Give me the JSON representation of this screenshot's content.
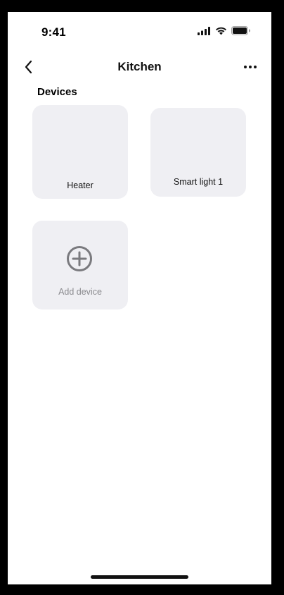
{
  "status_bar": {
    "time": "9:41",
    "icons": [
      "cellular-signal-icon",
      "wifi-icon",
      "battery-icon"
    ]
  },
  "nav": {
    "title": "Kitchen",
    "back_icon": "chevron-left-icon",
    "more_icon": "more-horizontal-icon"
  },
  "devices_section": {
    "title": "Devices",
    "items": [
      {
        "label": "Heater"
      },
      {
        "label": "Smart light 1"
      }
    ],
    "add": {
      "label": "Add device",
      "icon": "plus-circle-icon"
    }
  },
  "colors": {
    "card_background": "#efeff3",
    "add_icon": "#7a7a7e",
    "add_label": "#8a8a8e",
    "text_primary": "#111111"
  }
}
